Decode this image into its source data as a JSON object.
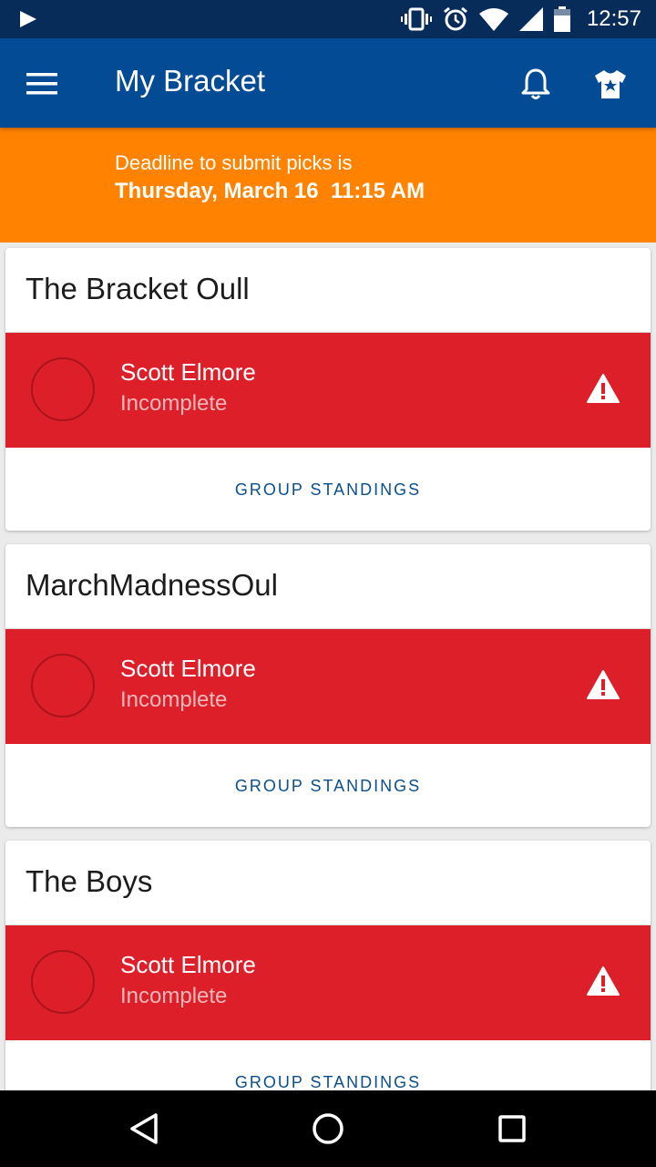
{
  "status_bar": {
    "time": "12:57",
    "icons": [
      "play-icon",
      "vibrate-icon",
      "alarm-icon",
      "wifi-icon",
      "signal-icon",
      "battery-icon"
    ]
  },
  "app_bar": {
    "title": "My Bracket",
    "icons": [
      "menu-icon",
      "bell-icon",
      "jersey-icon"
    ]
  },
  "banner": {
    "line1": "Deadline to submit picks is",
    "line2": "Thursday, March 16  11:15 AM"
  },
  "groups": [
    {
      "title": "The Bracket Oull",
      "entry": {
        "name": "Scott Elmore",
        "status": "Incomplete"
      },
      "standings_label": "GROUP STANDINGS"
    },
    {
      "title": "MarchMadnessOul",
      "entry": {
        "name": "Scott Elmore",
        "status": "Incomplete"
      },
      "standings_label": "GROUP STANDINGS"
    },
    {
      "title": "The Boys",
      "entry": {
        "name": "Scott Elmore",
        "status": "Incomplete"
      },
      "standings_label": "GROUP STANDINGS"
    }
  ],
  "colors": {
    "status_bar": "#082c59",
    "app_bar": "#034b94",
    "banner": "#ff8200",
    "entry_incomplete": "#dd1f2a",
    "link": "#0b4f8c"
  },
  "nav_bar": {
    "icons": [
      "back-icon",
      "home-icon",
      "recents-icon"
    ]
  }
}
